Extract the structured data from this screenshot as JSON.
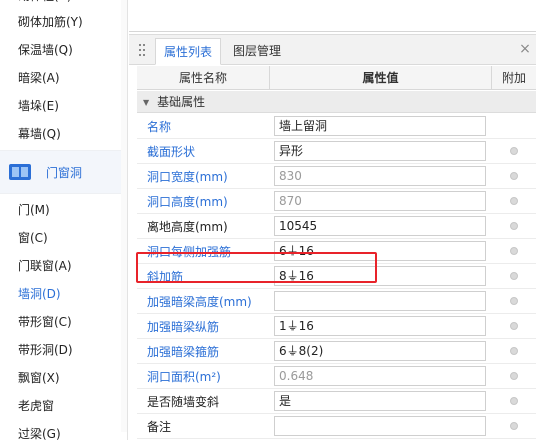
{
  "sidebar": {
    "items_top": [
      "砌体加筋(Y)",
      "保温墙(Q)",
      "暗梁(A)",
      "墙垛(E)",
      "幕墙(Q)"
    ],
    "category": {
      "label": "门窗洞",
      "icon": "door-window-icon"
    },
    "items_bottom": [
      {
        "label": "门(M)",
        "active": false
      },
      {
        "label": "窗(C)",
        "active": false
      },
      {
        "label": "门联窗(A)",
        "active": false
      },
      {
        "label": "墙洞(D)",
        "active": true
      },
      {
        "label": "带形窗(C)",
        "active": false
      },
      {
        "label": "带形洞(D)",
        "active": false
      },
      {
        "label": "飘窗(X)",
        "active": false
      },
      {
        "label": "老虎窗",
        "active": false
      },
      {
        "label": "过梁(G)",
        "active": false
      }
    ],
    "partial_top": "砌体柱(Z)"
  },
  "panel": {
    "tabs": [
      {
        "label": "属性列表",
        "active": true
      },
      {
        "label": "图层管理",
        "active": false
      }
    ],
    "close_icon": "close-icon",
    "columns": {
      "name": "属性名称",
      "value": "属性值",
      "extra": "附加"
    },
    "section": "基础属性",
    "rows": [
      {
        "name": "名称",
        "value": "墙上留洞",
        "link": true,
        "readonly": false,
        "dot": false
      },
      {
        "name": "截面形状",
        "value": "异形",
        "link": true,
        "readonly": false,
        "dot": true
      },
      {
        "name": "洞口宽度(mm)",
        "value": "830",
        "link": true,
        "readonly": true,
        "dot": true
      },
      {
        "name": "洞口高度(mm)",
        "value": "870",
        "link": true,
        "readonly": true,
        "dot": true
      },
      {
        "name": "离地高度(mm)",
        "value": "10545",
        "link": false,
        "readonly": false,
        "dot": true
      },
      {
        "name": "洞口每侧加强筋",
        "value": "6⏚16",
        "link": true,
        "readonly": false,
        "dot": true
      },
      {
        "name": "斜加筋",
        "value": "8⏚16",
        "link": true,
        "readonly": false,
        "dot": true
      },
      {
        "name": "加强暗梁高度(mm)",
        "value": "",
        "link": true,
        "readonly": false,
        "dot": true
      },
      {
        "name": "加强暗梁纵筋",
        "value": "1⏚16",
        "link": true,
        "readonly": false,
        "dot": true
      },
      {
        "name": "加强暗梁箍筋",
        "value": "6⏚8(2)",
        "link": true,
        "readonly": false,
        "dot": true
      },
      {
        "name": "洞口面积(m²)",
        "value": "0.648",
        "link": true,
        "readonly": true,
        "dot": true
      },
      {
        "name": "是否随墙变斜",
        "value": "是",
        "link": false,
        "readonly": false,
        "dot": true
      },
      {
        "name": "备注",
        "value": "",
        "link": false,
        "readonly": false,
        "dot": true
      }
    ]
  },
  "colors": {
    "accent": "#2b6fd6",
    "highlight": "#e8232a"
  }
}
